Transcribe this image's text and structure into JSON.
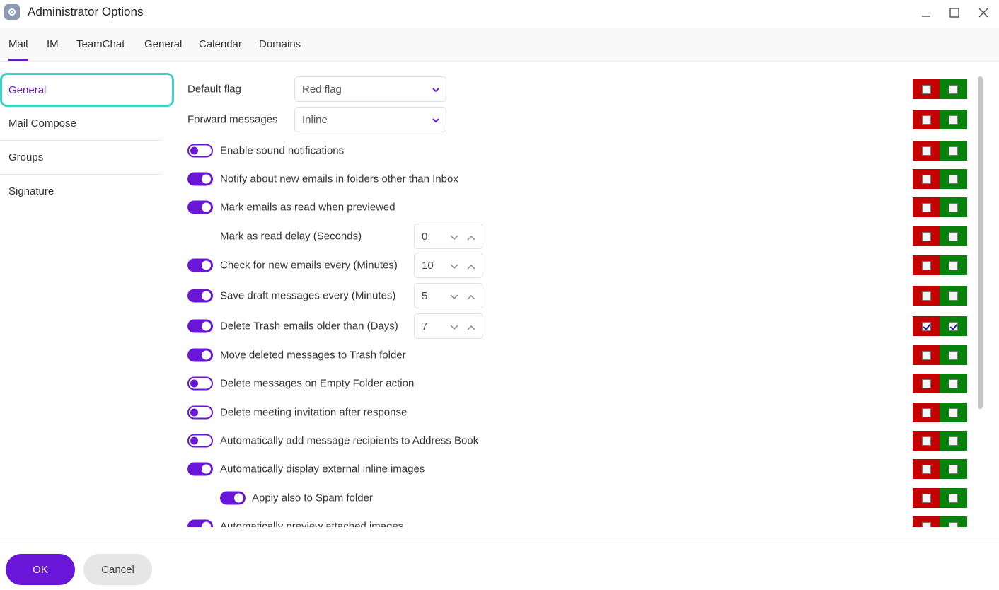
{
  "window": {
    "title": "Administrator Options",
    "icon": "gear-icon"
  },
  "tabs": [
    {
      "label": "Mail",
      "active": true
    },
    {
      "label": "IM"
    },
    {
      "label": "TeamChat"
    },
    {
      "label": "General"
    },
    {
      "label": "Calendar"
    },
    {
      "label": "Domains"
    }
  ],
  "sidebar": {
    "items": [
      {
        "label": "General",
        "active": true
      },
      {
        "label": "Mail Compose"
      },
      {
        "label": "Groups"
      },
      {
        "label": "Signature"
      }
    ]
  },
  "settings": {
    "default_flag": {
      "label": "Default flag",
      "value": "Red flag"
    },
    "forward_messages": {
      "label": "Forward messages",
      "value": "Inline"
    },
    "sound": {
      "label": "Enable sound notifications",
      "on": false
    },
    "notify_other": {
      "label": "Notify about new emails in folders other than Inbox",
      "on": true
    },
    "mark_read": {
      "label": "Mark emails as read when previewed",
      "on": true
    },
    "mark_delay": {
      "label": "Mark as read delay (Seconds)",
      "value": "0"
    },
    "check_new": {
      "label": "Check for new emails every (Minutes)",
      "on": true,
      "value": "10"
    },
    "save_draft": {
      "label": "Save draft messages every (Minutes)",
      "on": true,
      "value": "5"
    },
    "delete_trash": {
      "label": "Delete Trash emails older than (Days)",
      "on": true,
      "value": "7"
    },
    "move_deleted": {
      "label": "Move deleted messages to Trash folder",
      "on": true
    },
    "delete_empty": {
      "label": "Delete messages on Empty Folder action",
      "on": false
    },
    "delete_invite": {
      "label": "Delete meeting invitation after response",
      "on": false
    },
    "auto_add": {
      "label": "Automatically add message recipients to Address Book",
      "on": false
    },
    "auto_images": {
      "label": "Automatically display external inline images",
      "on": true
    },
    "spam_folder": {
      "label": "Apply also to Spam folder",
      "on": true
    },
    "preview_attached": {
      "label": "Automatically preview attached images",
      "on": true
    }
  },
  "colors": {
    "accent": "#6a16d8",
    "deny": "#c40000",
    "allow": "#07820a",
    "focus_ring": "#3fd3c6"
  },
  "footer": {
    "ok_label": "OK",
    "cancel_label": "Cancel"
  }
}
